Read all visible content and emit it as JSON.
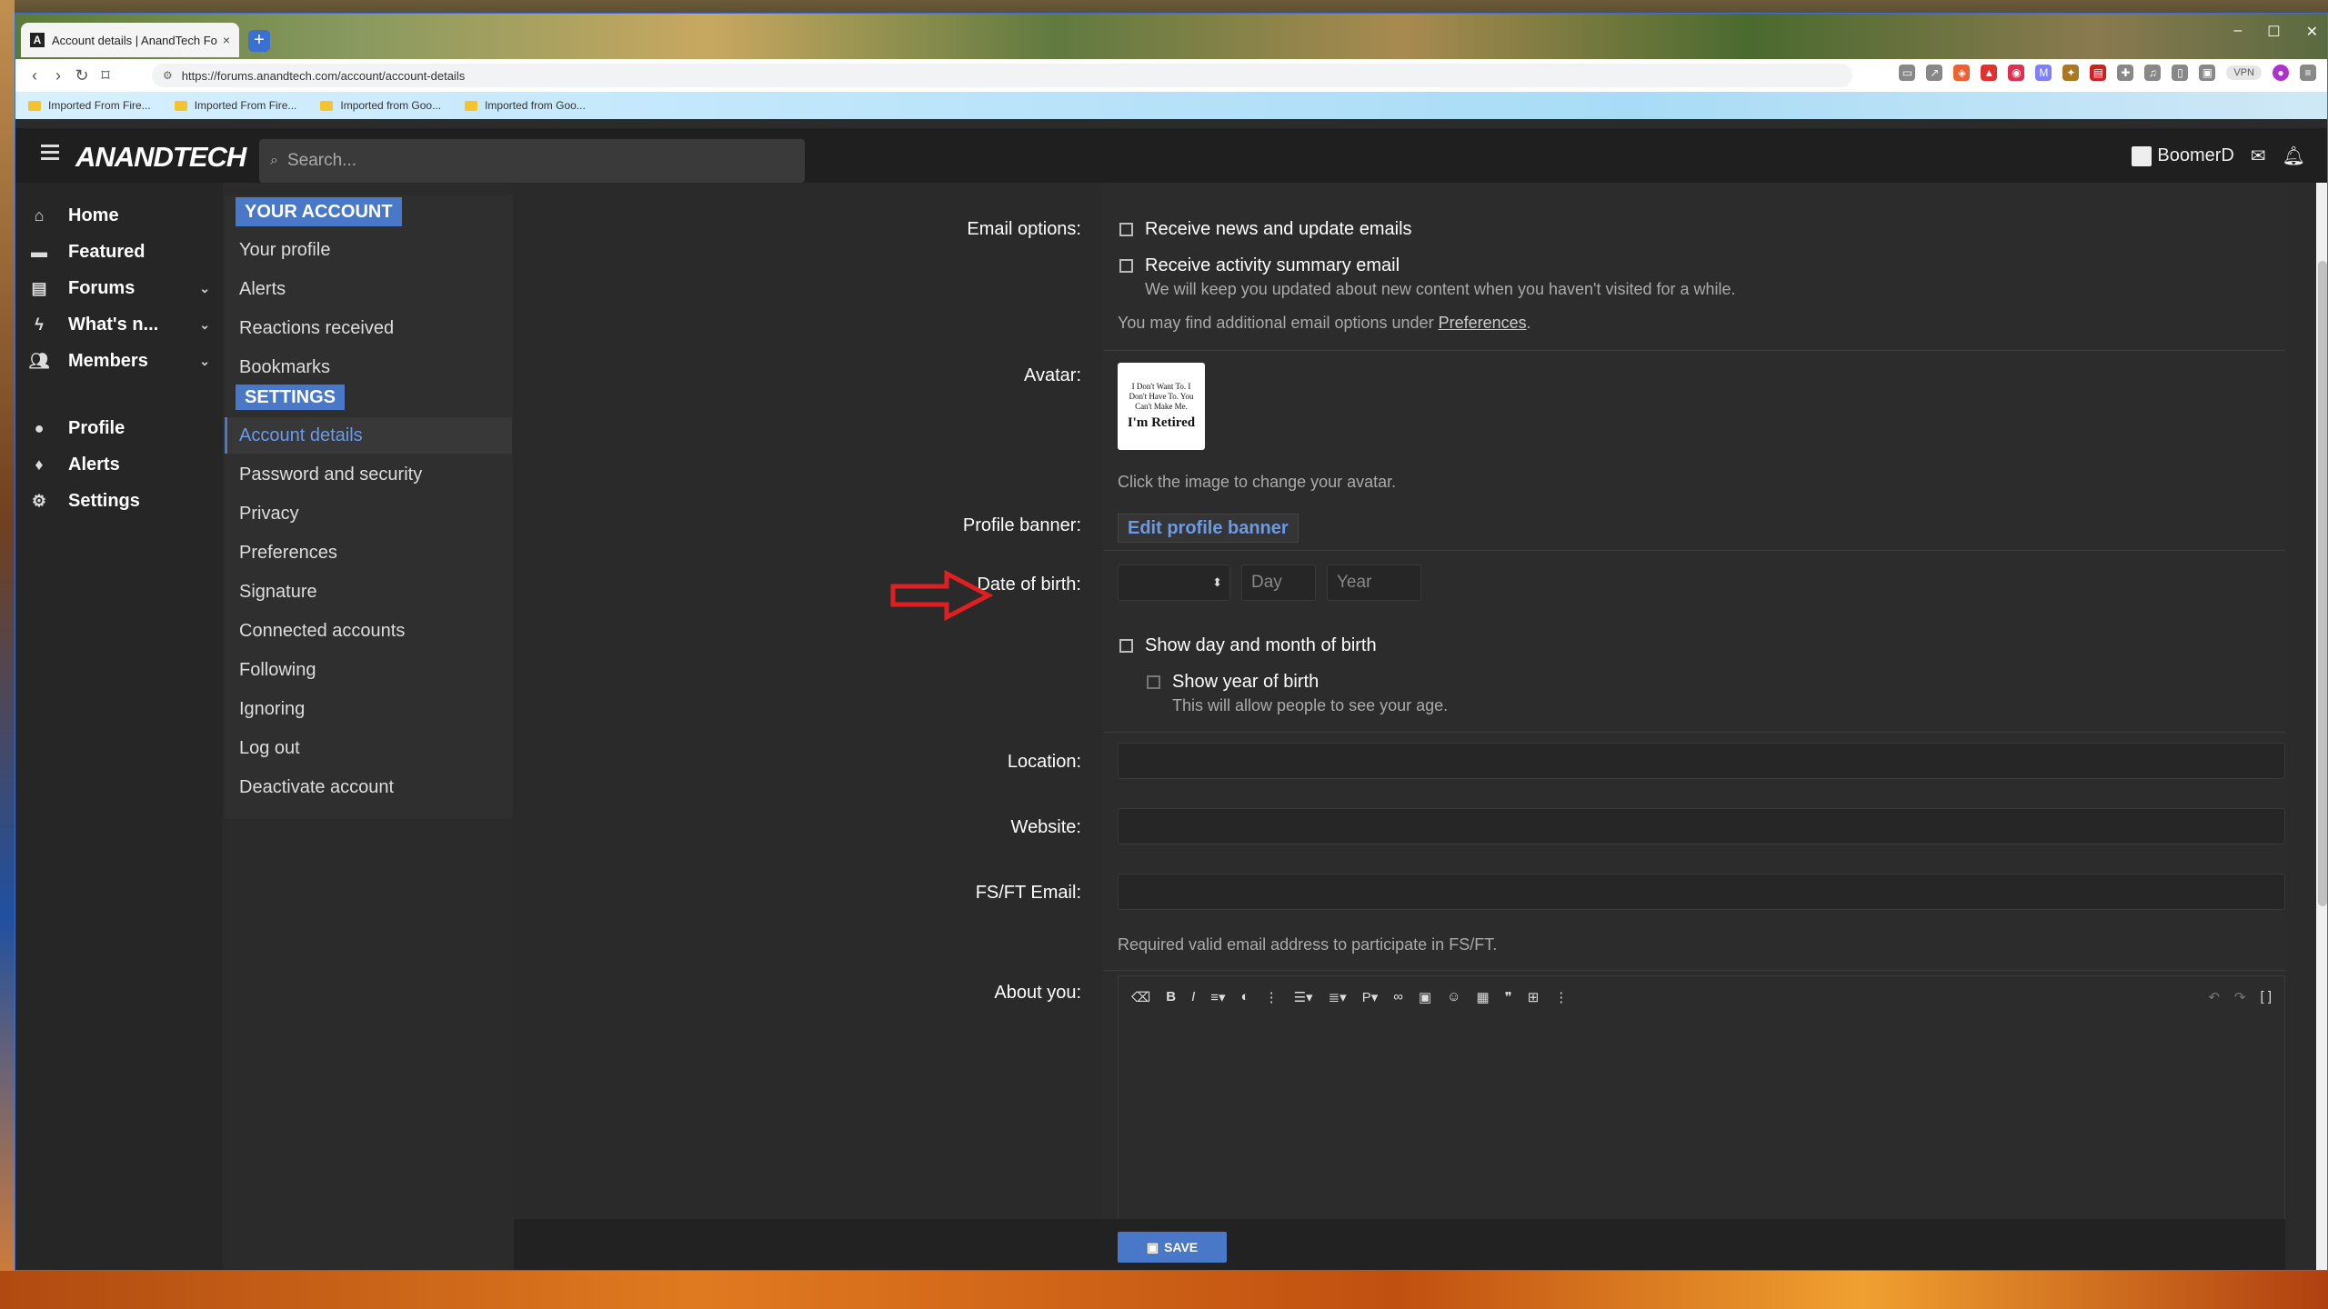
{
  "browser": {
    "tab_title": "Account details | AnandTech Fo",
    "tab_close": "×",
    "new_tab": "+",
    "url": "https://forums.anandtech.com/account/account-details",
    "vpn": "VPN",
    "bookmarks": [
      "Imported From Fire...",
      "Imported From Fire...",
      "Imported from Goo...",
      "Imported from Goo..."
    ]
  },
  "header": {
    "logo": "ANANDTECH",
    "search_placeholder": "Search...",
    "username": "BoomerD"
  },
  "leftnav": {
    "items": [
      {
        "label": "Home"
      },
      {
        "label": "Featured"
      },
      {
        "label": "Forums"
      },
      {
        "label": "What's n..."
      },
      {
        "label": "Members"
      },
      {
        "label": "Profile"
      },
      {
        "label": "Alerts"
      },
      {
        "label": "Settings"
      }
    ]
  },
  "account_menu": {
    "your_account_heading": "YOUR ACCOUNT",
    "your_account_items": [
      "Your profile",
      "Alerts",
      "Reactions received",
      "Bookmarks"
    ],
    "settings_heading": "SETTINGS",
    "settings_items": [
      "Account details",
      "Password and security",
      "Privacy",
      "Preferences",
      "Signature",
      "Connected accounts",
      "Following",
      "Ignoring",
      "Log out",
      "Deactivate account"
    ]
  },
  "form": {
    "email_options_label": "Email options:",
    "email_news": "Receive news and update emails",
    "email_activity": "Receive activity summary email",
    "email_activity_hint": "We will keep you updated about new content when you haven't visited for a while.",
    "email_more_prefix": "You may find additional email options under ",
    "email_more_link": "Preferences",
    "email_more_suffix": ".",
    "avatar_label": "Avatar:",
    "avatar_text_small": "I Don't Want To. I Don't Have To. You Can't Make Me.",
    "avatar_text_big": "I'm Retired",
    "avatar_hint": "Click the image to change your avatar.",
    "banner_label": "Profile banner:",
    "banner_button": "Edit profile banner",
    "dob_label": "Date of birth:",
    "dob_day_placeholder": "Day",
    "dob_year_placeholder": "Year",
    "show_day_month": "Show day and month of birth",
    "show_year": "Show year of birth",
    "show_year_hint": "This will allow people to see your age.",
    "location_label": "Location:",
    "website_label": "Website:",
    "fsft_label": "FS/FT Email:",
    "fsft_hint": "Required valid email address to participate in FS/FT.",
    "about_label": "About you:",
    "save_button": "SAVE"
  },
  "colors": {
    "accent": "#4a78c8",
    "link_active": "#6a9ae8",
    "annotation_arrow": "#e02020"
  }
}
